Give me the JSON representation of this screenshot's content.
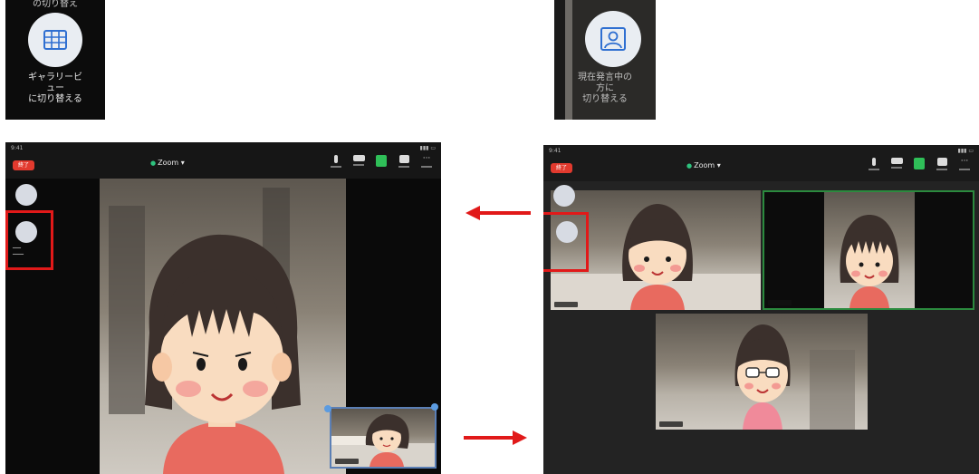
{
  "callouts": {
    "gallery": {
      "cut_label": "の切り替え",
      "label": "ギャラリービ\nュー\nに切り替える",
      "icon": "grid-icon"
    },
    "speaker": {
      "label": "現在発言中の\n方に\n切り替える",
      "icon": "person-frame-icon"
    }
  },
  "left_screen": {
    "status_time": "9:41",
    "leave_label": "終了",
    "title": "Zoom",
    "view": "speaker"
  },
  "right_screen": {
    "status_time": "9:41",
    "leave_label": "終了",
    "title": "Zoom",
    "view": "gallery"
  },
  "colors": {
    "highlight": "#e11919",
    "arrow": "#e11919",
    "leave": "#e23a2e",
    "video_on": "#2fbf58",
    "active_speaker_border": "#2b8a3e"
  }
}
